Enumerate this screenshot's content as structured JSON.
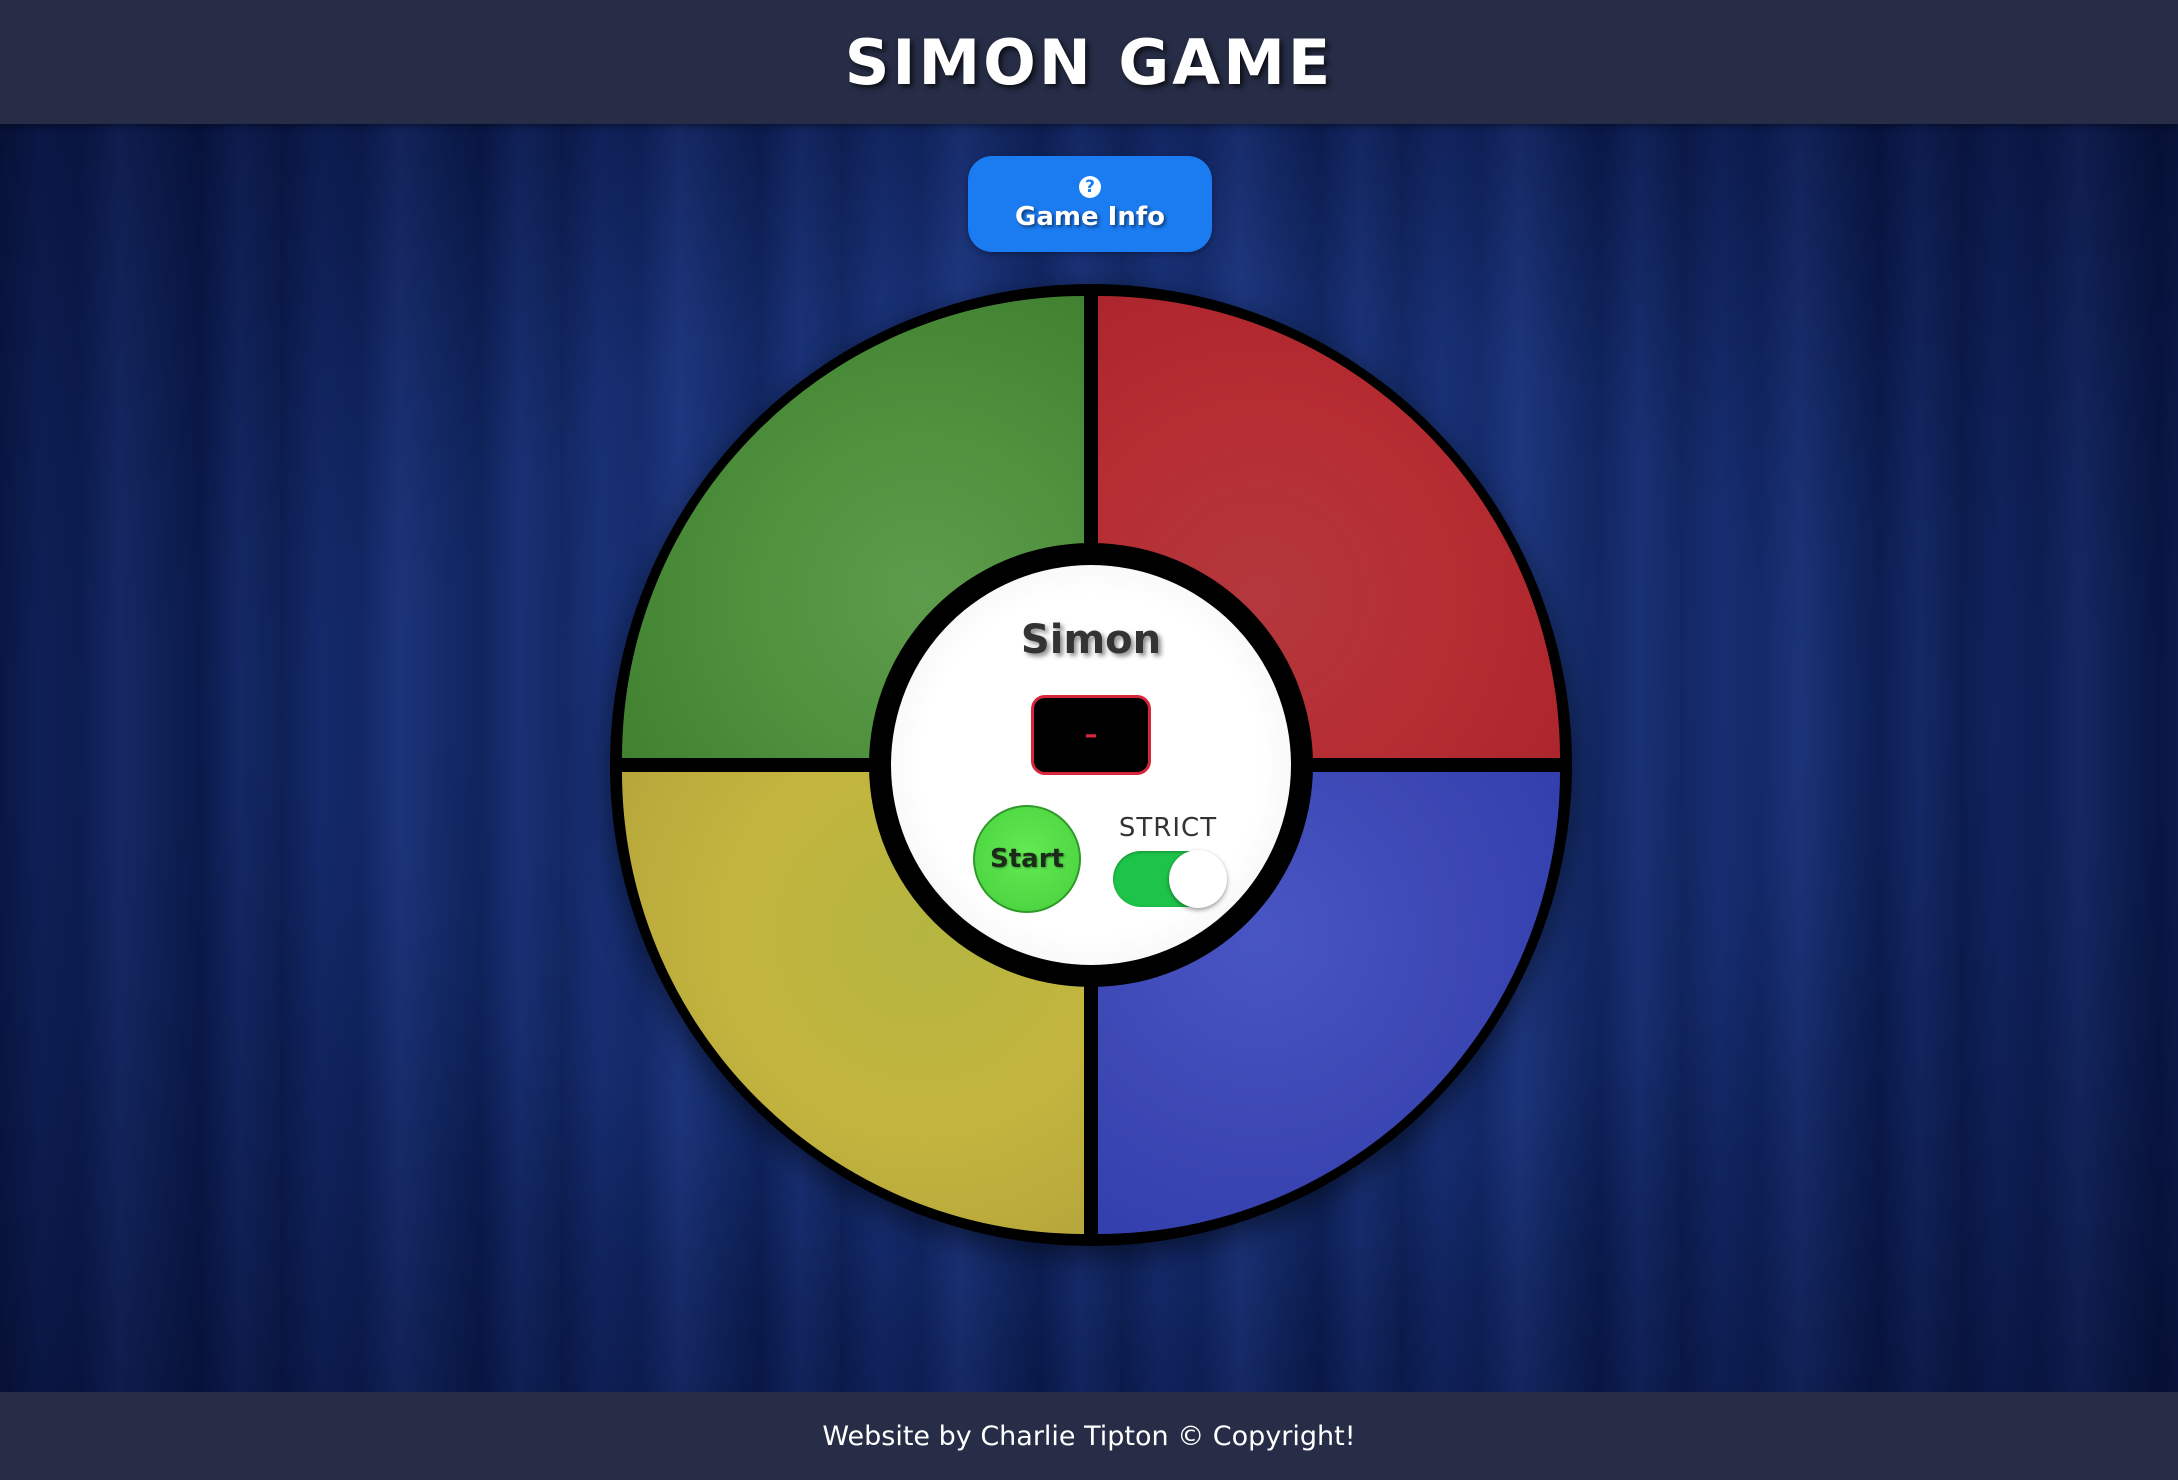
{
  "header": {
    "title": "SIMON GAME"
  },
  "info_button": {
    "icon": "question-circle-icon",
    "label": "Game Info"
  },
  "board": {
    "pads": [
      {
        "color_name": "green",
        "color": "#4f913d"
      },
      {
        "color_name": "red",
        "color": "#b62d32"
      },
      {
        "color_name": "yellow",
        "color": "#c3b53e"
      },
      {
        "color_name": "blue",
        "color": "#3d48b5"
      }
    ],
    "center": {
      "title": "Simon",
      "display_value": "–",
      "start_label": "Start",
      "strict_label": "STRICT",
      "strict_on": true
    }
  },
  "footer": {
    "text": "Website by Charlie Tipton © Copyright!"
  },
  "colors": {
    "header_bg": "#272d47",
    "info_button_bg": "#1b7cf2",
    "display_accent": "#d6263a",
    "start_button": "#4fd843",
    "toggle_on": "#1ec44a"
  }
}
